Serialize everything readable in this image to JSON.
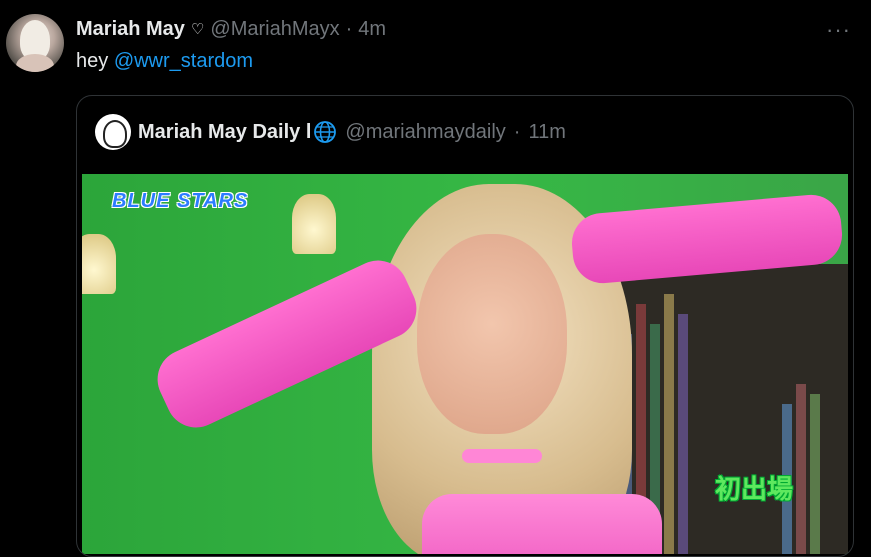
{
  "tweet": {
    "author_name": "Mariah May",
    "heart_glyph": "♡",
    "handle": "@MariahMayx",
    "separator": "·",
    "time": "4m",
    "more_glyph": "···",
    "text_prefix": "hey ",
    "mention": "@wwr_stardom"
  },
  "quote": {
    "author_name": "Mariah May Daily l",
    "handle": "@mariahmaydaily",
    "separator": "·",
    "time": "11m"
  },
  "media": {
    "caption_top_left": "BLUE STARS",
    "caption_bottom_right": "初出場"
  },
  "icons": [
    "more-icon",
    "globe-icon",
    "heart-icon"
  ],
  "colors": {
    "background": "#000000",
    "text": "#e7e9ea",
    "secondary": "#71767b",
    "link": "#1d9bf0",
    "border": "#2f3336"
  }
}
